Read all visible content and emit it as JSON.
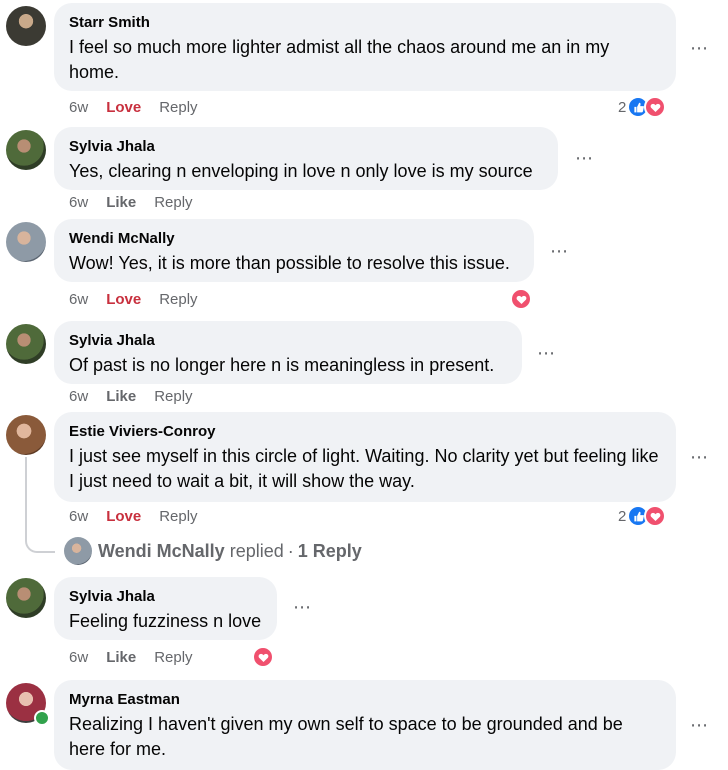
{
  "comments": [
    {
      "author": "Starr Smith",
      "text": "I feel so much more lighter admist all the chaos around me an in my home.",
      "time": "6w",
      "react_action": "Love",
      "reply_label": "Reply",
      "reaction_count": "2"
    },
    {
      "author": "Sylvia Jhala",
      "text": "Yes, clearing n enveloping in love n only love is my source",
      "time": "6w",
      "react_action": "Like",
      "reply_label": "Reply"
    },
    {
      "author": "Wendi McNally",
      "text": "Wow! Yes, it is more than possible to resolve this issue.",
      "time": "6w",
      "react_action": "Love",
      "reply_label": "Reply"
    },
    {
      "author": "Sylvia Jhala",
      "text": "Of past is no longer here n is meaningless in present.",
      "time": "6w",
      "react_action": "Like",
      "reply_label": "Reply"
    },
    {
      "author": "Estie Viviers-Conroy",
      "text": "I just see myself in this circle of light. Waiting. No clarity yet but feeling like I just need to wait a bit, it will show the way.",
      "time": "6w",
      "react_action": "Love",
      "reply_label": "Reply",
      "reaction_count": "2",
      "replies": {
        "name": "Wendi McNally",
        "verb": "replied",
        "separator": "·",
        "count": "1 Reply"
      }
    },
    {
      "author": "Sylvia Jhala",
      "text": "Feeling fuzziness n love",
      "time": "6w",
      "react_action": "Like",
      "reply_label": "Reply"
    },
    {
      "author": "Myrna Eastman",
      "text": "Realizing I haven't given my own self to space to be grounded and be here for me."
    }
  ],
  "more_icon": "⋯",
  "colors": {
    "bubble": "#f0f2f5",
    "love": "#c8303e",
    "like_blue": "#1877f2",
    "muted": "#65676b"
  }
}
